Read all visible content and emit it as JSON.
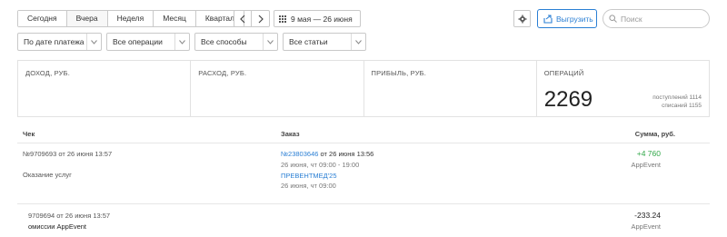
{
  "period_buttons": [
    {
      "label": "Сегодня"
    },
    {
      "label": "Вчера"
    },
    {
      "label": "Неделя"
    },
    {
      "label": "Месяц"
    },
    {
      "label": "Квартал"
    }
  ],
  "date_range": "9 мая — 26 июня",
  "export_label": "Выгрузить",
  "search_placeholder": "Поиск",
  "filters": [
    {
      "label": "По дате платежа"
    },
    {
      "label": "Все операции"
    },
    {
      "label": "Все способы"
    },
    {
      "label": "Все статьи"
    }
  ],
  "stats": {
    "income_label": "ДОХОД, РУБ.",
    "expense_label": "РАСХОД, РУБ.",
    "profit_label": "ПРИБЫЛЬ, РУБ.",
    "operations_label": "ОПЕРАЦИЙ",
    "operations_value": "2269",
    "incoming": "поступлений 1114",
    "writeoffs": "списаний 1155"
  },
  "table": {
    "col_check": "Чек",
    "col_order": "Заказ",
    "col_sum": "Сумма, руб."
  },
  "rows": [
    {
      "check": "№9709693 от 26 июня 13:57",
      "check_desc": "Оказание услуг",
      "order_link": "№23803646",
      "order_time": "от 26 июня 13:56",
      "order_slot": "26 июня, чт 09:00 - 19:00",
      "order_service": "ПРЕВЕНТМЕД'25",
      "order_slot2": "26 июня, чт 09:00",
      "amount": "+4 760",
      "source": "AppEvent"
    },
    {
      "check": "9709694 от 26 июня 13:57",
      "check_desc": "омиссии AppEvent",
      "amount": "-233.24",
      "source": "AppEvent"
    }
  ],
  "colors": {
    "accent": "#2a7fd4",
    "positive": "#33a84a"
  }
}
